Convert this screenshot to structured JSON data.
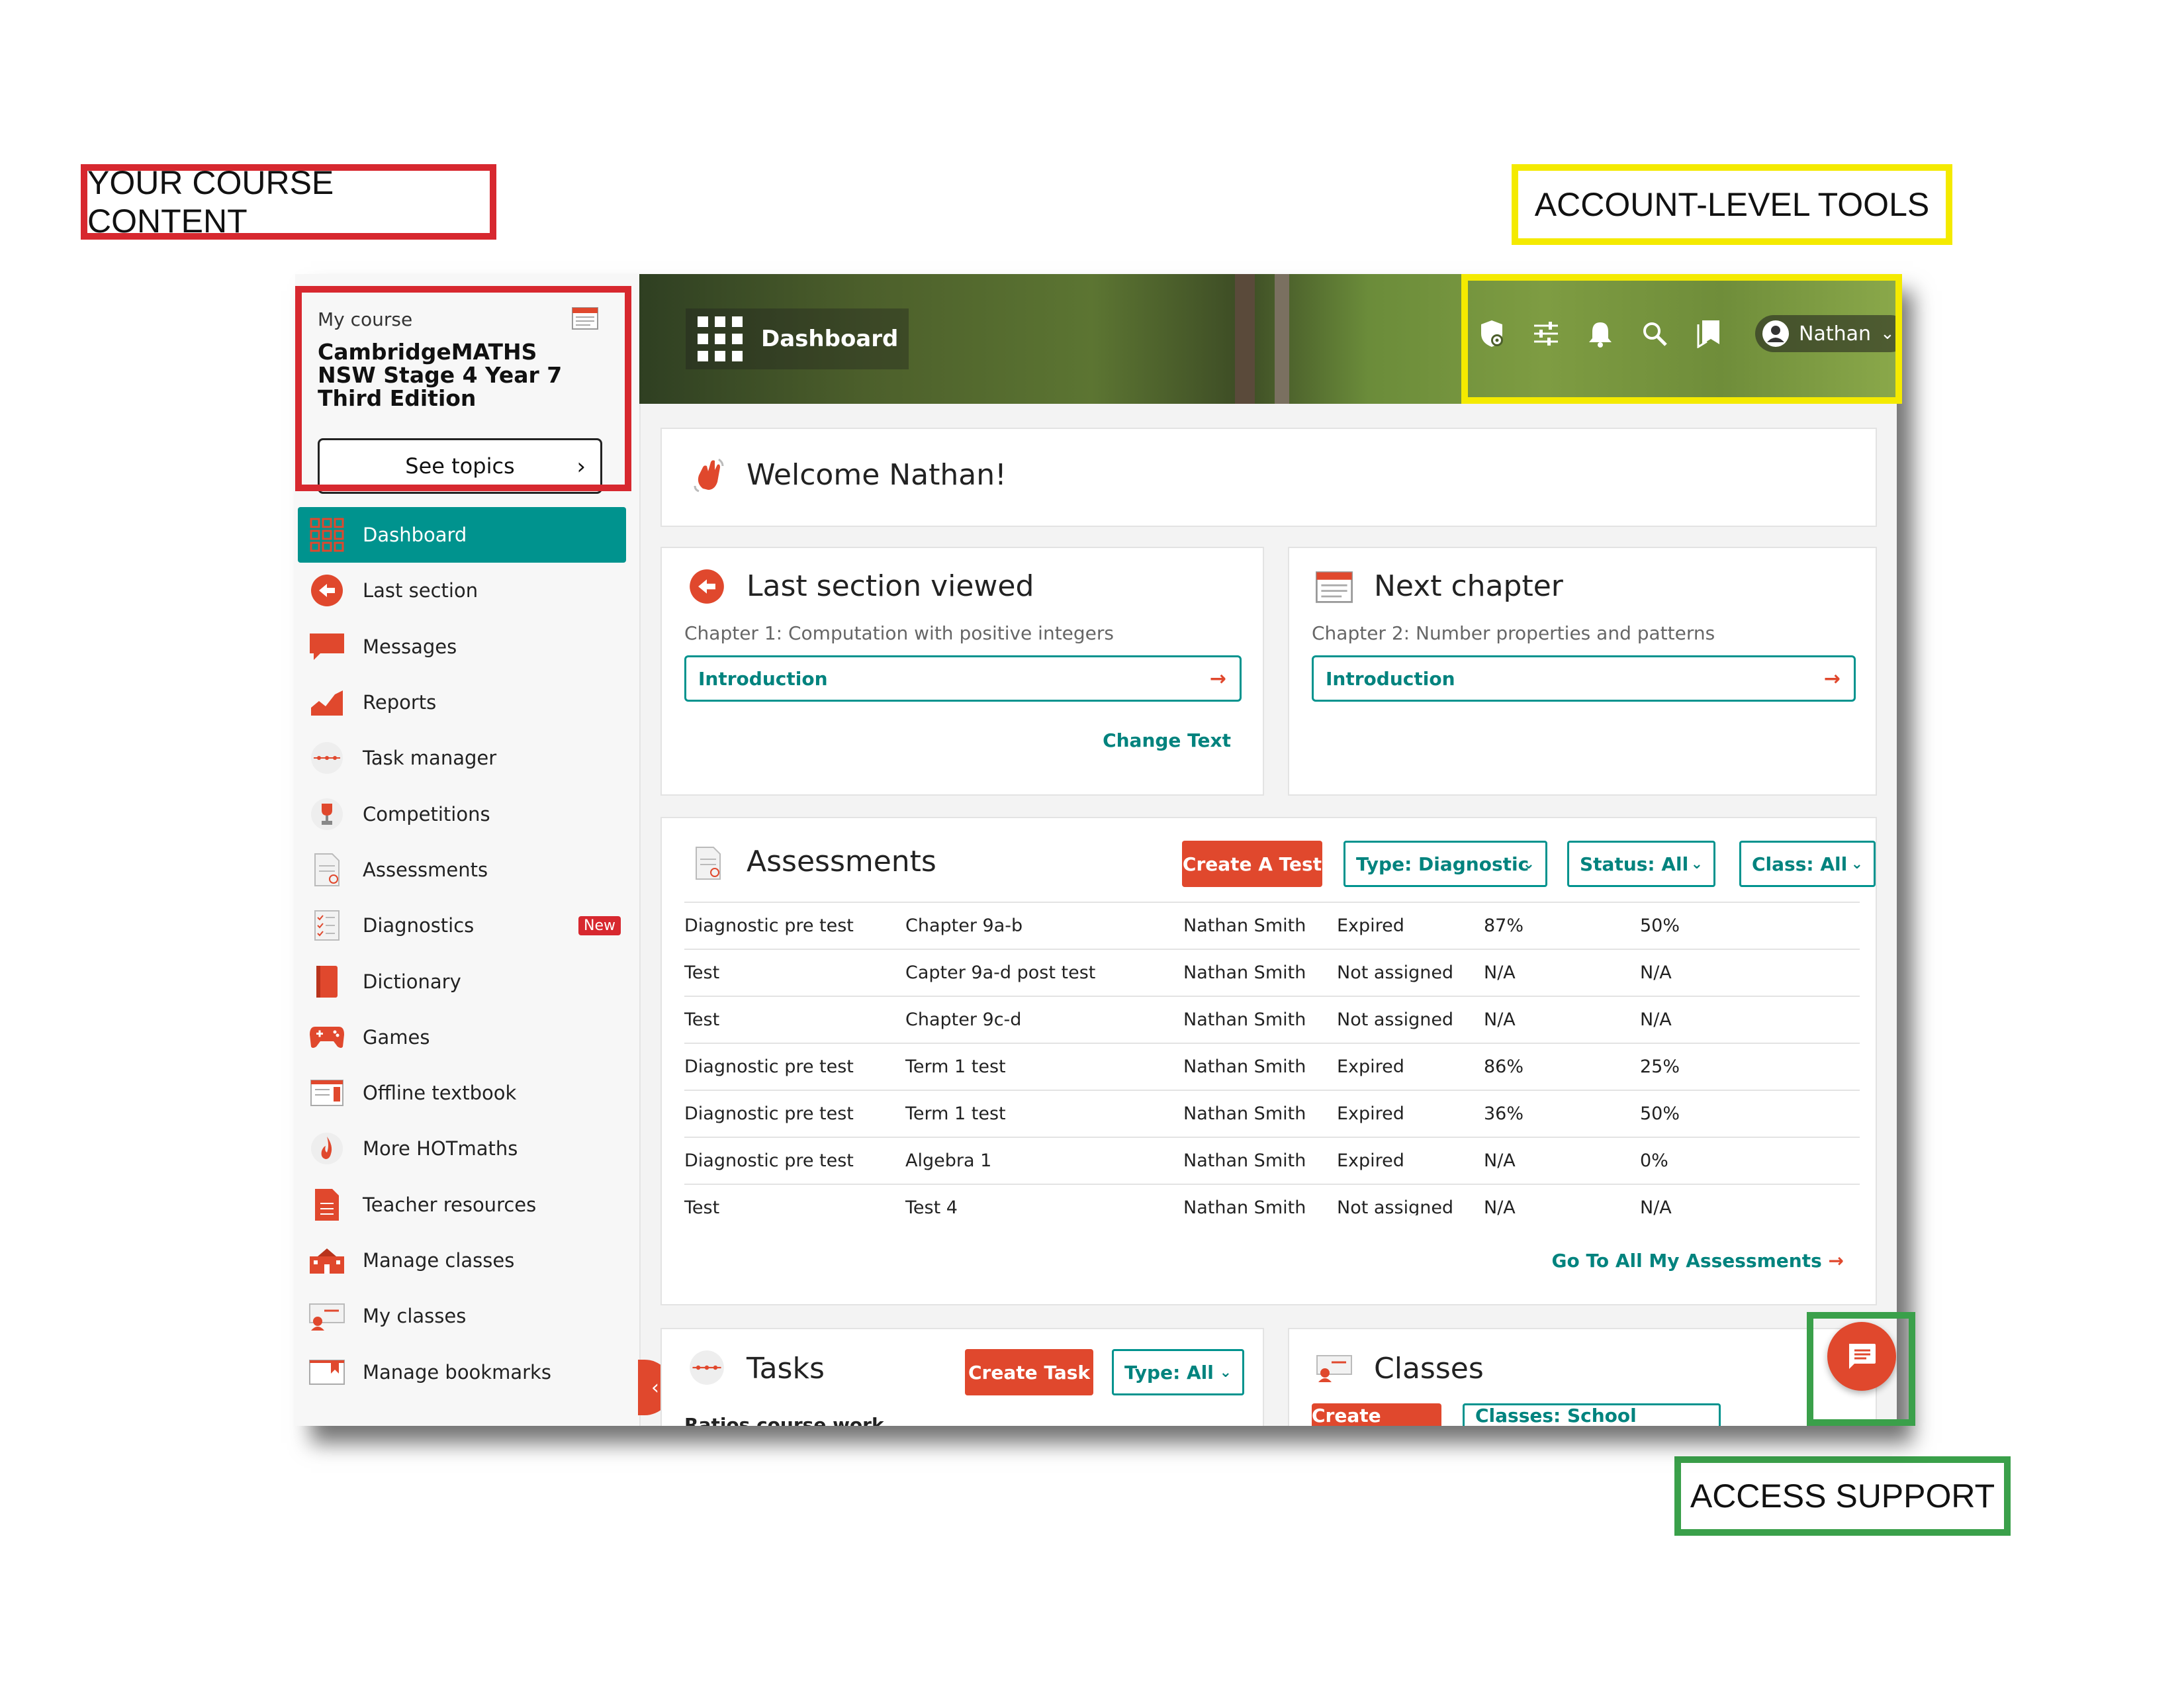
{
  "callouts": {
    "course_content": "YOUR COURSE CONTENT",
    "account_tools": "ACCOUNT-LEVEL TOOLS",
    "access_support": "ACCESS SUPPORT"
  },
  "colors": {
    "teal": "#00938e",
    "orange": "#e0482d",
    "red_callout": "#d7282f",
    "yellow_callout": "#f4ea00",
    "green_callout": "#3aa04a"
  },
  "sidebar": {
    "course_label": "My course",
    "course_title": "CambridgeMATHS NSW Stage 4 Year 7 Third Edition",
    "see_topics": "See topics",
    "items": [
      {
        "label": "Dashboard",
        "icon": "grid-icon",
        "active": true
      },
      {
        "label": "Last section",
        "icon": "back-arrow-icon"
      },
      {
        "label": "Messages",
        "icon": "speech-bubble-icon"
      },
      {
        "label": "Reports",
        "icon": "chart-icon"
      },
      {
        "label": "Task manager",
        "icon": "timeline-icon"
      },
      {
        "label": "Competitions",
        "icon": "trophy-icon"
      },
      {
        "label": "Assessments",
        "icon": "document-icon"
      },
      {
        "label": "Diagnostics",
        "icon": "checklist-icon",
        "badge": "New"
      },
      {
        "label": "Dictionary",
        "icon": "book-icon"
      },
      {
        "label": "Games",
        "icon": "gamepad-icon"
      },
      {
        "label": "Offline textbook",
        "icon": "textbook-icon"
      },
      {
        "label": "More HOTmaths",
        "icon": "flame-icon"
      },
      {
        "label": "Teacher resources",
        "icon": "page-icon"
      },
      {
        "label": "Manage classes",
        "icon": "school-icon"
      },
      {
        "label": "My classes",
        "icon": "classes-icon"
      },
      {
        "label": "Manage bookmarks",
        "icon": "bookmark-book-icon"
      }
    ]
  },
  "header": {
    "title": "Dashboard",
    "user": "Nathan",
    "icons": [
      "shield-gear-icon",
      "sliders-icon",
      "bell-icon",
      "search-icon",
      "bookmarks-icon"
    ]
  },
  "welcome": {
    "text": "Welcome Nathan!"
  },
  "last_section": {
    "title": "Last section viewed",
    "chapter": "Chapter 1: Computation with positive integers",
    "link": "Introduction",
    "change_text": "Change Text"
  },
  "next_chapter": {
    "title": "Next chapter",
    "chapter": "Chapter 2: Number properties and patterns",
    "link": "Introduction"
  },
  "assessments": {
    "title": "Assessments",
    "create": "Create A Test",
    "filter_type": "Type: Diagnostic",
    "filter_status": "Status: All",
    "filter_class": "Class: All",
    "rows": [
      [
        "Diagnostic pre test",
        "Chapter 9a-b",
        "Nathan Smith",
        "Expired",
        "87%",
        "50%"
      ],
      [
        "Test",
        "Capter 9a-d post test",
        "Nathan Smith",
        "Not assigned",
        "N/A",
        "N/A"
      ],
      [
        "Test",
        "Chapter 9c-d",
        "Nathan Smith",
        "Not assigned",
        "N/A",
        "N/A"
      ],
      [
        "Diagnostic pre test",
        "Term 1 test",
        "Nathan Smith",
        "Expired",
        "86%",
        "25%"
      ],
      [
        "Diagnostic pre test",
        "Term 1 test",
        "Nathan Smith",
        "Expired",
        "36%",
        "50%"
      ],
      [
        "Diagnostic pre test",
        "Algebra 1",
        "Nathan Smith",
        "Expired",
        "N/A",
        "0%"
      ],
      [
        "Test",
        "Test 4",
        "Nathan Smith",
        "Not assigned",
        "N/A",
        "N/A"
      ]
    ],
    "go_all": "Go To All My Assessments"
  },
  "tasks": {
    "title": "Tasks",
    "create": "Create Task",
    "filter_type": "Type: All",
    "first_row": "Ratios course work"
  },
  "classes": {
    "title": "Classes",
    "create": "Create Class",
    "filter": "Classes: School Classes"
  }
}
